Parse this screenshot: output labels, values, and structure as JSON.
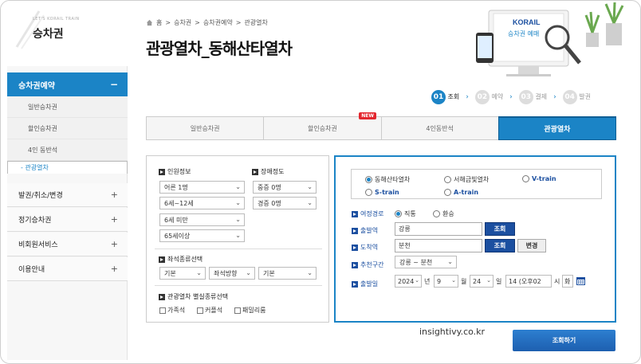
{
  "sidebar": {
    "brand_sub": "LET'S KORAIL TRAIN",
    "brand_title": "승차권",
    "active_menu": "승차권예약",
    "submenu": [
      "일반승차권",
      "할인승차권",
      "4인 동반석"
    ],
    "selected_submenu": "- 관광열차",
    "menu": [
      "발권/취소/변경",
      "정기승차권",
      "비회원서비스",
      "이용안내"
    ]
  },
  "header": {
    "breadcrumb": [
      "홈",
      "승차권",
      "승차권예약",
      "관광열차"
    ],
    "title": "관광열차_동해산타열차",
    "hero_logo": "KORAIL",
    "hero_text": "승차권 예매"
  },
  "steps": [
    {
      "num": "01",
      "label": "조회"
    },
    {
      "num": "02",
      "label": "예약"
    },
    {
      "num": "03",
      "label": "결제"
    },
    {
      "num": "04",
      "label": "발권"
    }
  ],
  "tabs": [
    "일반승차권",
    "할인승차권",
    "4인동반석",
    "관광열차"
  ],
  "new_badge": "NEW",
  "passengers": {
    "label": "인원정보",
    "adult": "어른 1명",
    "child": "6세~12세",
    "infant": "6세 미만",
    "senior": "65세이상"
  },
  "disability": {
    "label": "장애정도",
    "severe": "중증 0명",
    "mild": "경증 0명"
  },
  "seat_type": {
    "label": "좌석종류선택",
    "opt1": "기본",
    "opt2": "좌석방향",
    "opt3": "기본"
  },
  "special_seat": {
    "label": "관광열차 별실종류선택",
    "options": [
      "가족석",
      "커플석",
      "패밀리룸"
    ]
  },
  "trains": [
    "동해산타열차",
    "서해금빛열차",
    "V-train",
    "S-train",
    "A-train"
  ],
  "route": {
    "label": "여정경로",
    "direct": "직통",
    "transfer": "환승"
  },
  "departure": {
    "label": "출발역",
    "value": "강릉",
    "btn": "조회"
  },
  "arrival": {
    "label": "도착역",
    "value": "분천",
    "btn": "조회",
    "swap": "변경"
  },
  "recommend": {
    "label": "추천구간",
    "value": "강릉 ~ 분천"
  },
  "date": {
    "label": "출발일",
    "year": "2024",
    "year_unit": "년",
    "month": "9",
    "month_unit": "월",
    "day": "24",
    "day_unit": "일",
    "hour": "14 (오후02",
    "hour_unit": "시",
    "weekday": "화"
  },
  "watermark": "insightivy.co.kr",
  "search_button": "조회하기",
  "colors": {
    "accent": "#1b84c6",
    "navy": "#1b4fa0",
    "badge": "#e3262e"
  }
}
